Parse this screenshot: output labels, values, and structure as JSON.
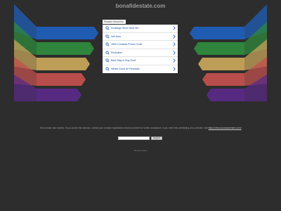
{
  "site": {
    "title": "bonafidestate.com"
  },
  "related_label": "Related Searches:",
  "links": [
    {
      "label": "Invisalign Store Near Me"
    },
    {
      "label": "Sell Auto"
    },
    {
      "label": "1800 Contacts Promo Code"
    },
    {
      "label": "Reduction"
    },
    {
      "label": "Best Way to Buy Gold"
    },
    {
      "label": "Whats Good for Psoriasis"
    }
  ],
  "disclaimer": {
    "text": "This domain has expired. If you owned this domain, contact your domain registration service provider for further assistance. If you need help identifying your provider, visit",
    "link": "https://www.tucowsdomains.com/"
  },
  "search": {
    "value": "",
    "button_label": "Search"
  },
  "privacy_label": "Privacy Policy",
  "colors": {
    "background": "#2d2d2d",
    "bands": [
      "#1f5fb8",
      "#2f8a3c",
      "#c6a35a",
      "#c0504d",
      "#5a2a86"
    ],
    "link_text": "#1a4fa0",
    "icon": "#1f5fb8"
  },
  "icons": {
    "link_icon": "search-icon",
    "link_arrow": "chevron-right-icon"
  }
}
